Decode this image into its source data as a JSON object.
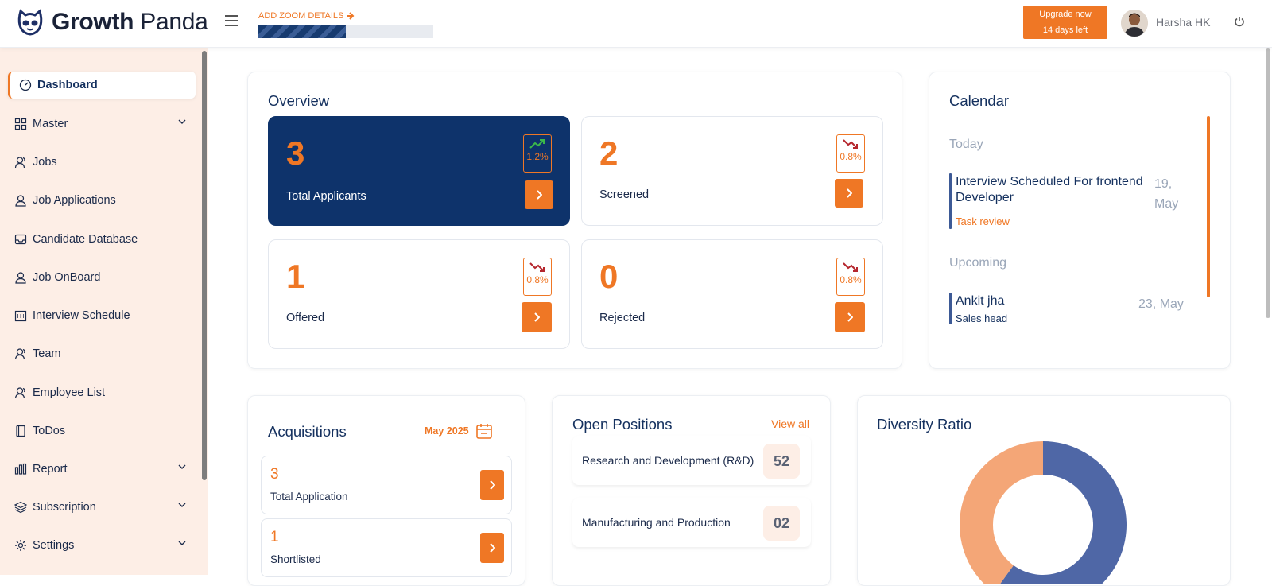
{
  "header": {
    "logo_text_1": "Growth",
    "logo_text_2": "Panda",
    "zoom_link": "ADD ZOOM DETAILS",
    "zoom_progress": 0.5,
    "upgrade_line1": "Upgrade now",
    "upgrade_line2": "14 days left",
    "user_name": "Harsha HK"
  },
  "sidebar": {
    "items": [
      {
        "label": "Dashboard",
        "icon": "gauge-icon",
        "active": true
      },
      {
        "label": "Master",
        "icon": "grid-icon",
        "expandable": true
      },
      {
        "label": "Jobs",
        "icon": "users-icon"
      },
      {
        "label": "Job Applications",
        "icon": "user-icon"
      },
      {
        "label": "Candidate Database",
        "icon": "inbox-icon"
      },
      {
        "label": "Job OnBoard",
        "icon": "user-icon"
      },
      {
        "label": "Interview Schedule",
        "icon": "calendar-icon"
      },
      {
        "label": "Team",
        "icon": "users-icon"
      },
      {
        "label": "Employee List",
        "icon": "users-icon"
      },
      {
        "label": "ToDos",
        "icon": "note-icon"
      },
      {
        "label": "Report",
        "icon": "bar-chart-icon",
        "expandable": true
      },
      {
        "label": "Subscription",
        "icon": "layers-icon",
        "expandable": true
      },
      {
        "label": "Settings",
        "icon": "gear-icon",
        "expandable": true
      }
    ]
  },
  "overview": {
    "title": "Overview",
    "stats": [
      {
        "value": "3",
        "label": "Total Applicants",
        "trend": "1.2%",
        "direction": "up"
      },
      {
        "value": "2",
        "label": "Screened",
        "trend": "0.8%",
        "direction": "down"
      },
      {
        "value": "1",
        "label": "Offered",
        "trend": "0.8%",
        "direction": "down"
      },
      {
        "value": "0",
        "label": "Rejected",
        "trend": "0.8%",
        "direction": "down"
      }
    ]
  },
  "calendar": {
    "title": "Calendar",
    "today_label": "Today",
    "today_event": {
      "title": "Interview Scheduled For frontend Developer",
      "sub": "Task review",
      "date_line1": "19,",
      "date_line2": "May"
    },
    "upcoming_label": "Upcoming",
    "upcoming_event": {
      "title": "Ankit jha",
      "sub": "Sales head",
      "date": "23, May"
    }
  },
  "acquisitions": {
    "title": "Acquisitions",
    "month": "May 2025",
    "items": [
      {
        "value": "3",
        "label": "Total Application"
      },
      {
        "value": "1",
        "label": "Shortlisted"
      }
    ]
  },
  "open_positions": {
    "title": "Open Positions",
    "view_all": "View all",
    "items": [
      {
        "name": "Research and Development (R&D)",
        "count": "52"
      },
      {
        "name": "Manufacturing and Production",
        "count": "02"
      }
    ]
  },
  "diversity": {
    "title": "Diversity Ratio"
  },
  "chart_data": {
    "type": "pie",
    "title": "Diversity Ratio",
    "values": [
      0.6,
      0.4
    ],
    "colors": [
      "#4f67a6",
      "#f4a677"
    ]
  },
  "colors": {
    "accent": "#ef7725",
    "navy": "#0e336b",
    "sidebar_bg": "#fdeee6"
  }
}
